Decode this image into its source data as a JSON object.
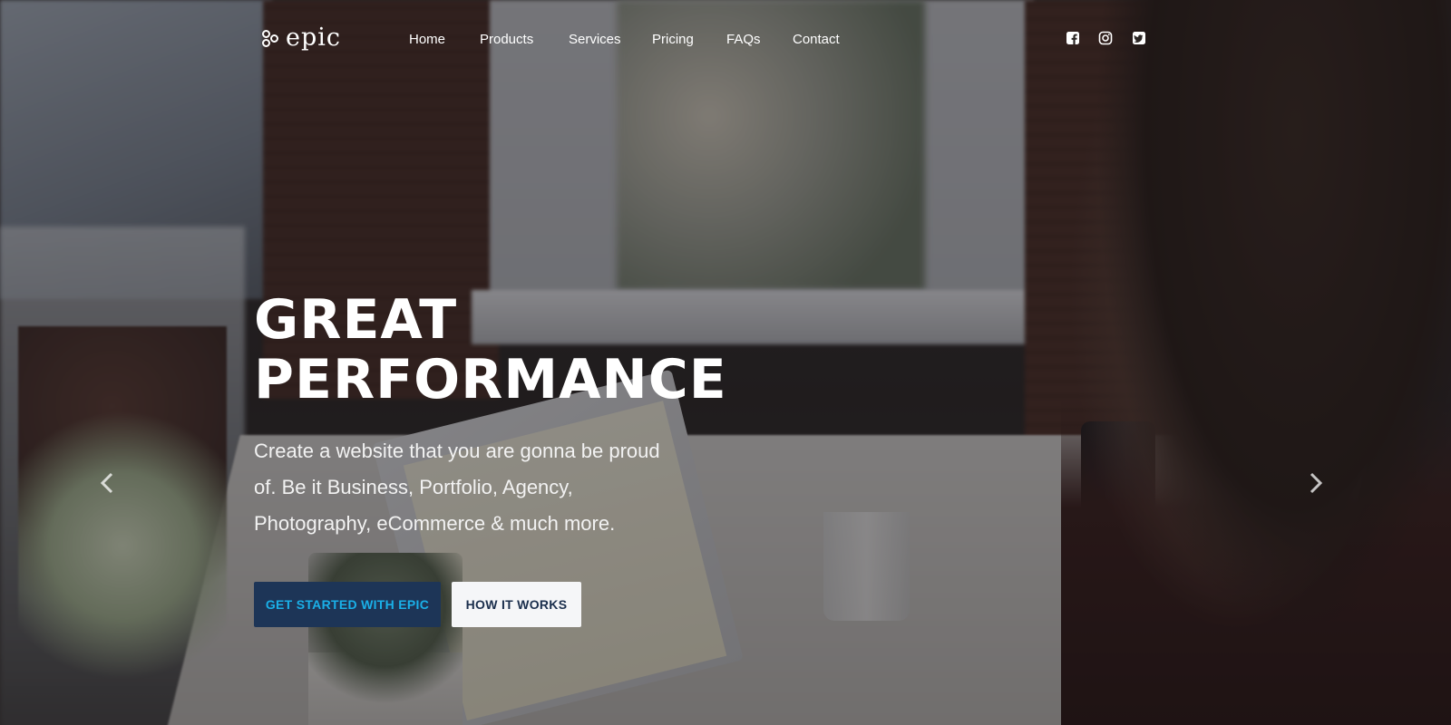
{
  "brand": {
    "name": "epic",
    "icon": "trefoil-logo-icon"
  },
  "nav": {
    "items": [
      {
        "label": "Home"
      },
      {
        "label": "Products"
      },
      {
        "label": "Services"
      },
      {
        "label": "Pricing"
      },
      {
        "label": "FAQs"
      },
      {
        "label": "Contact"
      }
    ]
  },
  "social": [
    {
      "icon": "facebook-icon"
    },
    {
      "icon": "instagram-icon"
    },
    {
      "icon": "twitter-icon"
    }
  ],
  "hero": {
    "title_line1": "GREAT",
    "title_line2": "PERFORMANCE",
    "description": "Create a website that you are gonna be proud of. Be it Business, Portfolio, Agency, Photography, eCommerce & much more.",
    "primary_button": "GET STARTED WITH EPIC",
    "secondary_button": "HOW IT WORKS"
  },
  "carousel": {
    "prev_icon": "chevron-left-icon",
    "next_icon": "chevron-right-icon"
  },
  "colors": {
    "primary_button_bg": "#1d3557",
    "primary_button_text": "#1ab0e8",
    "secondary_button_bg": "#f5f6f8",
    "secondary_button_text": "#1b2f4d",
    "text": "#ffffff"
  }
}
